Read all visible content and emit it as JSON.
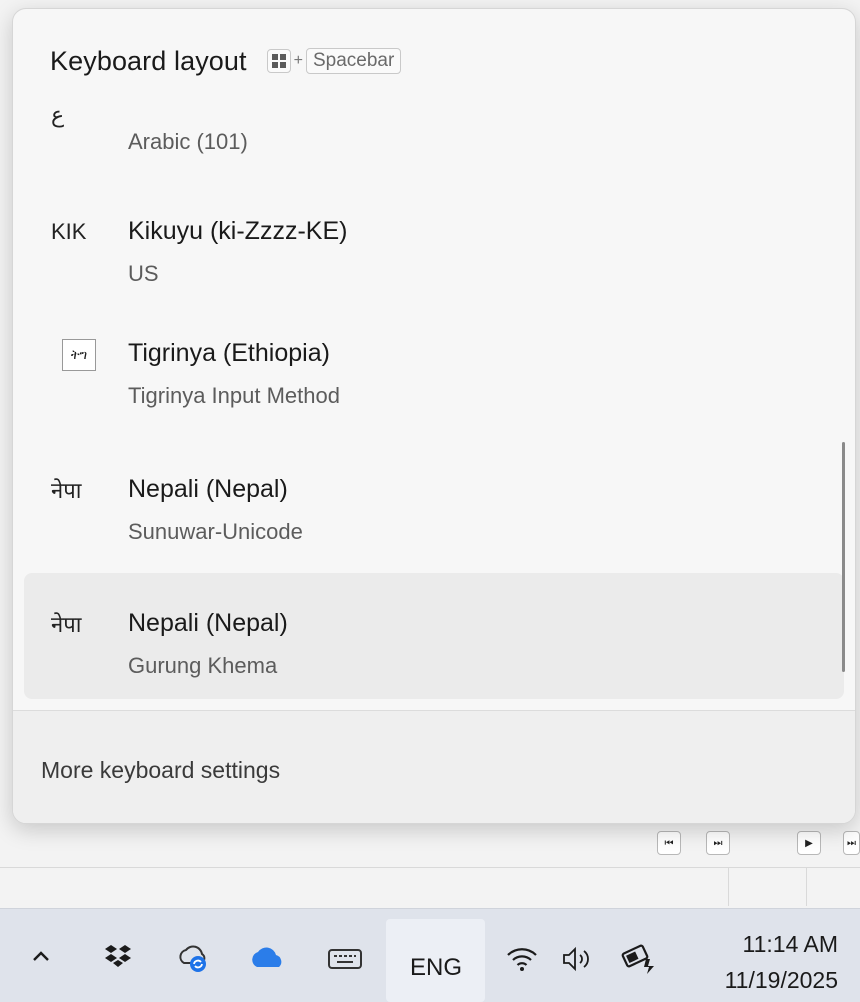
{
  "flyout": {
    "title": "Keyboard layout",
    "shortcut_plus": "+",
    "shortcut_key": "Spacebar",
    "items": [
      {
        "abbr": "ع",
        "name": "",
        "layout": "Arabic (101)",
        "selected": false
      },
      {
        "abbr": "KIK",
        "name": "Kikuyu (ki-Zzzz-KE)",
        "layout": "US",
        "selected": false
      },
      {
        "abbr": "ትግ",
        "name": "Tigrinya (Ethiopia)",
        "layout": "Tigrinya Input Method",
        "selected": false
      },
      {
        "abbr": "नेपा",
        "name": "Nepali (Nepal)",
        "layout": "Sunuwar-Unicode",
        "selected": false
      },
      {
        "abbr": "नेपा",
        "name": "Nepali (Nepal)",
        "layout": "Gurung Khema",
        "selected": true
      }
    ],
    "footer_link": "More keyboard settings"
  },
  "taskbar": {
    "icons": [
      "chevron-up-icon",
      "dropbox-icon",
      "cloud-sync-icon",
      "onedrive-icon",
      "touch-keyboard-icon",
      "wifi-icon",
      "volume-icon",
      "battery-icon"
    ],
    "input_indicator": "ENG",
    "time": "11:14 AM",
    "date": "11/19/2025"
  },
  "colors": {
    "accent_blue": "#1e73e8",
    "onedrive_blue": "#2b7de9"
  }
}
